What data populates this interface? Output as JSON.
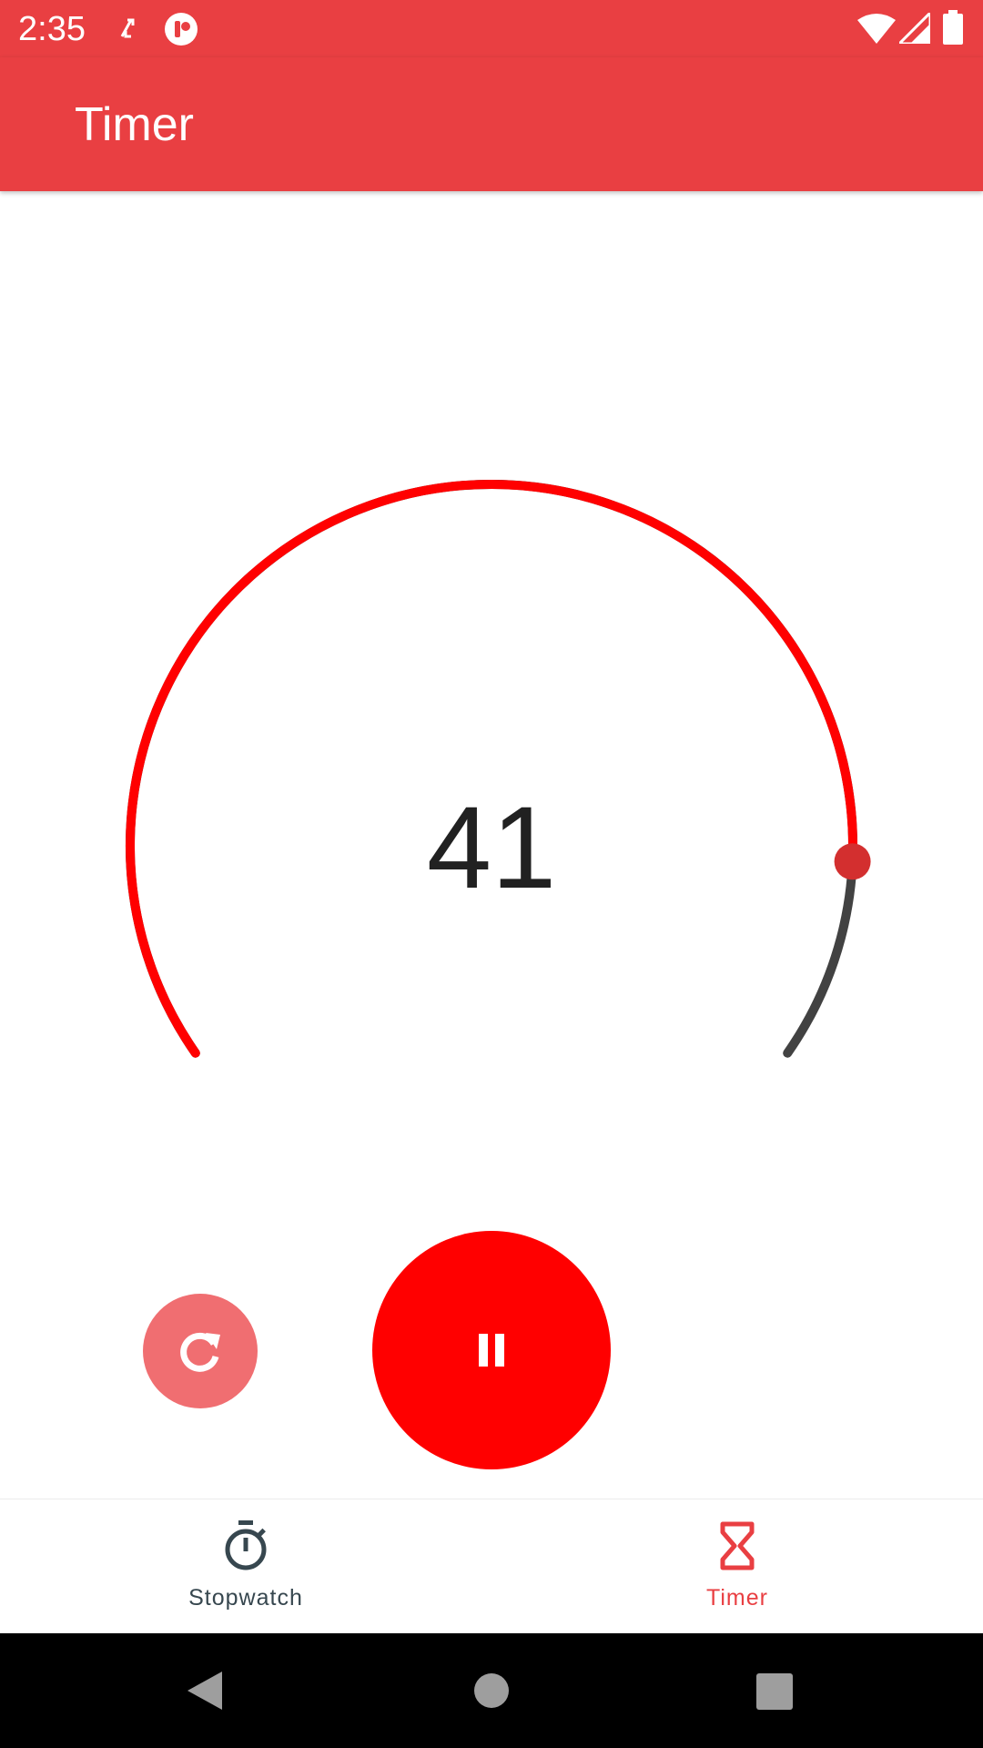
{
  "status_bar": {
    "time": "2:35",
    "icons": [
      "sync-icon",
      "notification-icon",
      "wifi-icon",
      "signal-icon",
      "battery-icon"
    ]
  },
  "app_bar": {
    "title": "Timer"
  },
  "timer": {
    "value": "41",
    "progress_fraction": 0.87,
    "colors": {
      "elapsed": "#ff0000",
      "remaining": "#424242",
      "thumb": "#d32f2f"
    }
  },
  "controls": {
    "reset_icon": "refresh-icon",
    "pause_icon": "pause-icon"
  },
  "bottom_nav": {
    "items": [
      {
        "label": "Stopwatch",
        "icon": "stopwatch-icon",
        "active": false
      },
      {
        "label": "Timer",
        "icon": "hourglass-icon",
        "active": true
      }
    ],
    "active_color": "#e93f42",
    "inactive_color": "#37474f"
  },
  "system_nav": {
    "icons": [
      "back-icon",
      "home-icon",
      "recents-icon"
    ]
  },
  "colors": {
    "primary": "#e93f42",
    "fab": "#ff0000",
    "fab_secondary": "#f06e71"
  }
}
